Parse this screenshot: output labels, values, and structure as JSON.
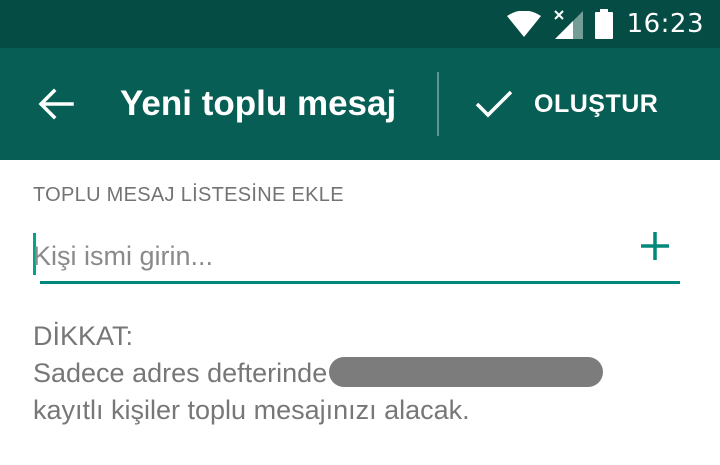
{
  "status_bar": {
    "wifi_icon": "wifi-icon",
    "signal_icon": "signal-no-data-icon",
    "battery_icon": "battery-icon",
    "time": "16:23"
  },
  "toolbar": {
    "back_icon": "arrow-back-icon",
    "title": "Yeni toplu mesaj",
    "create_icon": "check-icon",
    "create_label": "OLUŞTUR"
  },
  "form": {
    "section_header": "TOPLU MESAJ LİSTESİNE EKLE",
    "input_placeholder": "Kişi ismi girin...",
    "input_value": "",
    "add_icon": "plus-icon"
  },
  "notice": {
    "heading": "DİKKAT:",
    "line1": "Sadece adres defterinde",
    "line2": "kayıtlı kişiler toplu mesajınızı alacak."
  },
  "colors": {
    "status_bar": "#054d44",
    "toolbar": "#075e54",
    "accent": "#00897b"
  }
}
